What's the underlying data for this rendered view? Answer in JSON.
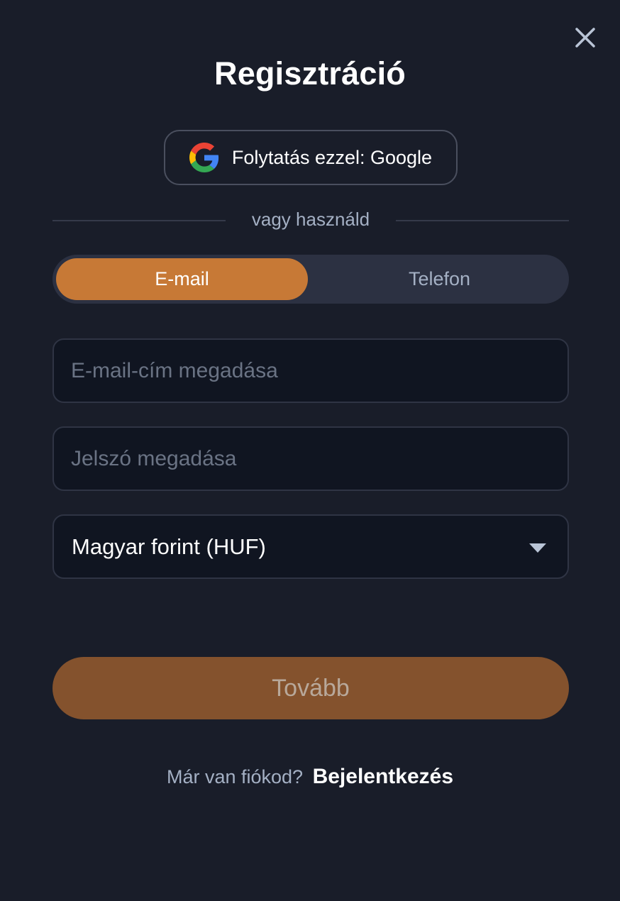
{
  "modal": {
    "title": "Regisztráció",
    "close_icon": "close-icon"
  },
  "google": {
    "icon": "google-icon",
    "label": "Folytatás ezzel: Google"
  },
  "divider": {
    "text": "vagy használd"
  },
  "tabs": [
    {
      "label": "E-mail",
      "active": true
    },
    {
      "label": "Telefon",
      "active": false
    }
  ],
  "form": {
    "email": {
      "placeholder": "E-mail-cím megadása",
      "value": ""
    },
    "password": {
      "placeholder": "Jelszó megadása",
      "value": ""
    },
    "currency": {
      "selected": "Magyar forint (HUF)",
      "icon": "chevron-down-icon"
    }
  },
  "submit": {
    "label": "Tovább"
  },
  "footer": {
    "question": "Már van fiókod?",
    "login_link": "Bejelentkezés"
  },
  "colors": {
    "background": "#191d29",
    "accent": "#c77936",
    "accent_disabled": "#84522d",
    "field_bg": "#101521"
  }
}
